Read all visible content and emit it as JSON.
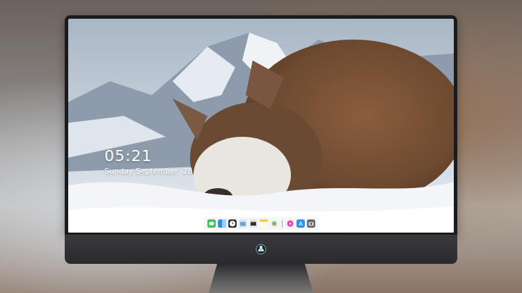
{
  "lock_screen": {
    "time": "05:21",
    "date": "Sunday September  28"
  }
}
